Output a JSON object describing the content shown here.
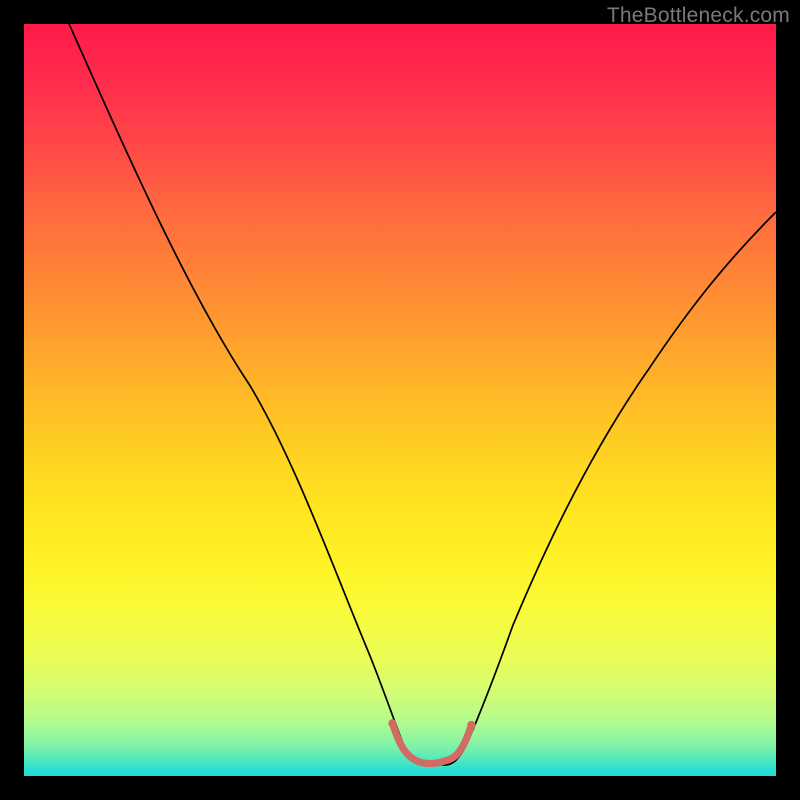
{
  "watermark": {
    "text": "TheBottleneck.com"
  },
  "chart_data": {
    "type": "line",
    "title": "",
    "xlabel": "",
    "ylabel": "",
    "xlim": [
      0,
      100
    ],
    "ylim": [
      0,
      100
    ],
    "grid": false,
    "legend": false,
    "background": {
      "gradient_direction": "vertical",
      "stops": [
        {
          "pos": 0.0,
          "color": "#ff1a4a"
        },
        {
          "pos": 0.5,
          "color": "#ffc024"
        },
        {
          "pos": 0.8,
          "color": "#f5fb40"
        },
        {
          "pos": 1.0,
          "color": "#21dbd8"
        }
      ]
    },
    "series": [
      {
        "name": "bottleneck-curve",
        "stroke": "#000000",
        "stroke_width": 1.6,
        "x": [
          6,
          12,
          18,
          24,
          30,
          36,
          42,
          46,
          49,
          52,
          55,
          58,
          62,
          68,
          74,
          80,
          86,
          92,
          98
        ],
        "y": [
          100,
          88,
          76,
          64,
          52,
          40,
          28,
          16,
          7,
          1.5,
          2.0,
          1.5,
          7,
          18,
          30,
          41,
          51,
          60,
          68
        ]
      },
      {
        "name": "optimal-band",
        "stroke": "#d46a64",
        "stroke_width": 6,
        "cap": "round",
        "x": [
          49,
          50.5,
          52,
          53.5,
          55,
          56.5,
          58
        ],
        "y": [
          7,
          3.5,
          2.0,
          1.4,
          2.0,
          3.5,
          7
        ]
      }
    ],
    "annotations": []
  }
}
